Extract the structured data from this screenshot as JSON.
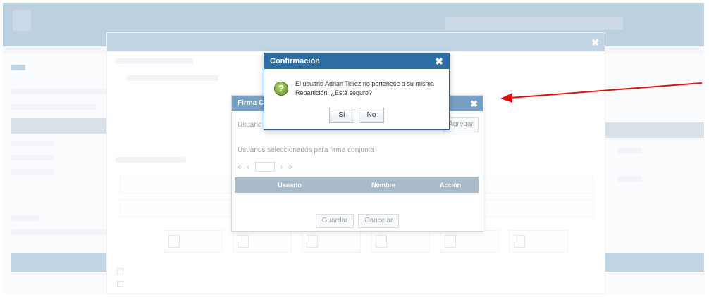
{
  "app": {
    "title_line1": "",
    "title_line2": "",
    "user": "",
    "tabs": [
      "",
      "",
      ""
    ]
  },
  "big_modal": {
    "title": "",
    "footer_check1": "",
    "footer_check2": ""
  },
  "firma_modal": {
    "title": "Firma Co",
    "user_label": "Usuario",
    "add_button": "Agregar",
    "list_label": "Usuarios seleccionados para firma conjunta",
    "pager": {
      "first": "«",
      "prev": "‹",
      "next": "›",
      "last": "»"
    },
    "grid_columns": [
      "Usuario",
      "Nombre",
      "Acción"
    ],
    "save_button": "Guardar",
    "cancel_button": "Cancelar"
  },
  "confirm_dialog": {
    "title": "Confirmación",
    "close_icon": "✖",
    "icon_glyph": "?",
    "message": "El usuario Adrian Tellez no pertenece a su misma Repartición. ¿Está seguro?",
    "yes_button": "Sí",
    "no_button": "No"
  },
  "colors": {
    "header_blue": "#2e6da4",
    "annotation_red": "#e01010",
    "question_green": "#6a9a30"
  },
  "icons": [
    "question-icon",
    "close-icon",
    "document-icon",
    "checkbox-icon"
  ]
}
